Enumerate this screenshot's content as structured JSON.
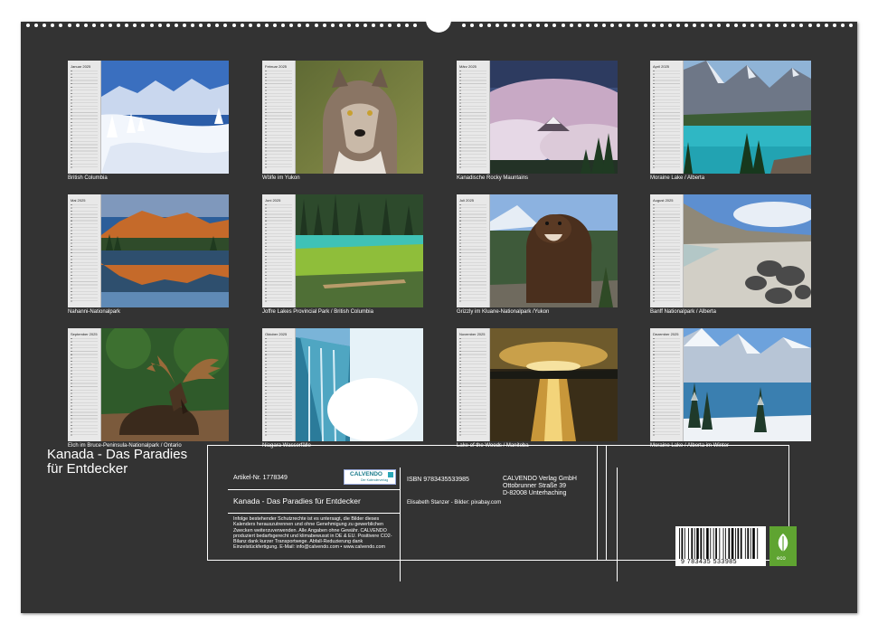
{
  "months": [
    {
      "month": "Januar 2025",
      "caption": "British Columbia",
      "photo": "snowy-mountains"
    },
    {
      "month": "Februar 2025",
      "caption": "Wölfe im Yukon",
      "photo": "wolf"
    },
    {
      "month": "März 2025",
      "caption": "Kanadische Rocky Mauntains",
      "photo": "cloud-peak"
    },
    {
      "month": "April 2025",
      "caption": "Moraine Lake / Alberta",
      "photo": "turquoise-lake"
    },
    {
      "month": "Mai 2025",
      "caption": "Nahanni-Nationalpark",
      "photo": "mountain-reflection"
    },
    {
      "month": "Juni 2025",
      "caption": "Joffre Lakes Provincial Park / British Columbia",
      "photo": "green-lake"
    },
    {
      "month": "Juli 2025",
      "caption": "Grizzly im Kluane-Nationalpark /Yukon",
      "photo": "grizzly"
    },
    {
      "month": "August 2025",
      "caption": "Banff Nationalpark / Alberta",
      "photo": "rocky-shore"
    },
    {
      "month": "September 2025",
      "caption": "Elch im Bruce-Peninsula-Nationalpark / Ontario",
      "photo": "moose"
    },
    {
      "month": "Oktober 2025",
      "caption": "Niagara Wasserfälle",
      "photo": "waterfall"
    },
    {
      "month": "November 2025",
      "caption": "Lake of the Woods / Manitoba",
      "photo": "sunset-lake"
    },
    {
      "month": "Dezember 2025",
      "caption": "Moraine Lake / Alberta im Winter",
      "photo": "winter-lake"
    }
  ],
  "title": "Kanada - Das Paradies für Entdecker",
  "info": {
    "article": "Artikel-Nr. 1778349",
    "logo_main": "CALVENDO",
    "logo_sub": "Der Kalenderverlag",
    "product_title": "Kanada - Das Paradies für Entdecker",
    "legal": "Infolge bestehender Schutzrechte ist es untersagt, die Bilder dieses Kalenders herauszutrennen und ohne Genehmigung zu gewerblichen Zwecken weiterzuverwenden. Alle Angaben ohne Gewähr. CALVENDO produziert bedarfsgerecht und klimabewusst in DE & EU. Positivere CO2-Bilanz dank kurzer Transportwege. Abfall-Reduzierung dank Einzelstückfertigung. E-Mail: info@calvendo.com • www.calvendo.com",
    "isbn": "ISBN 9783435533985",
    "publisher_line1": "CALVENDO Verlag GmbH",
    "publisher_line2": "Ottobrunner Straße 39",
    "publisher_line3": "D-82008 Unterhaching",
    "credits": "Elisabeth Stanzer - Bilder: pixabay.com",
    "barcode_number": "9 783435 533985",
    "eco_label": "eco"
  },
  "colors": {
    "board": "#333333",
    "text": "#ffffff",
    "eco": "#5fa431",
    "logo": "#1a7b8c"
  }
}
